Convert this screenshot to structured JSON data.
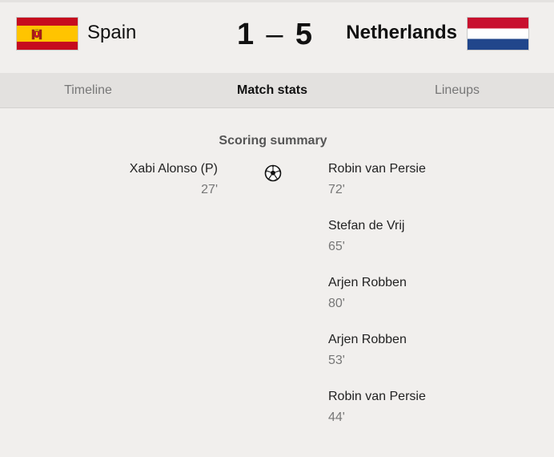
{
  "match": {
    "home_team": "Spain",
    "away_team": "Netherlands",
    "home_score": "1",
    "score_separator": "–",
    "away_score": "5"
  },
  "tabs": [
    {
      "label": "Timeline",
      "active": false
    },
    {
      "label": "Match stats",
      "active": true
    },
    {
      "label": "Lineups",
      "active": false
    }
  ],
  "scoring_summary": {
    "title": "Scoring summary",
    "home_goals": [
      {
        "player": "Xabi Alonso (P)",
        "minute": "27'"
      }
    ],
    "away_goals": [
      {
        "player": "Robin van Persie",
        "minute": "72'"
      },
      {
        "player": "Stefan de Vrij",
        "minute": "65'"
      },
      {
        "player": "Arjen Robben",
        "minute": "80'"
      },
      {
        "player": "Arjen Robben",
        "minute": "53'"
      },
      {
        "player": "Robin van Persie",
        "minute": "44'"
      }
    ]
  },
  "icons": {
    "home_flag": "spain-flag-icon",
    "away_flag": "netherlands-flag-icon",
    "goal": "soccer-ball-icon"
  },
  "colors": {
    "background": "#f1efed",
    "tabbar": "#e3e1df",
    "spain_red": "#c60b1e",
    "spain_yellow": "#ffc400",
    "nl_red": "#c8102e",
    "nl_blue": "#21468b"
  }
}
